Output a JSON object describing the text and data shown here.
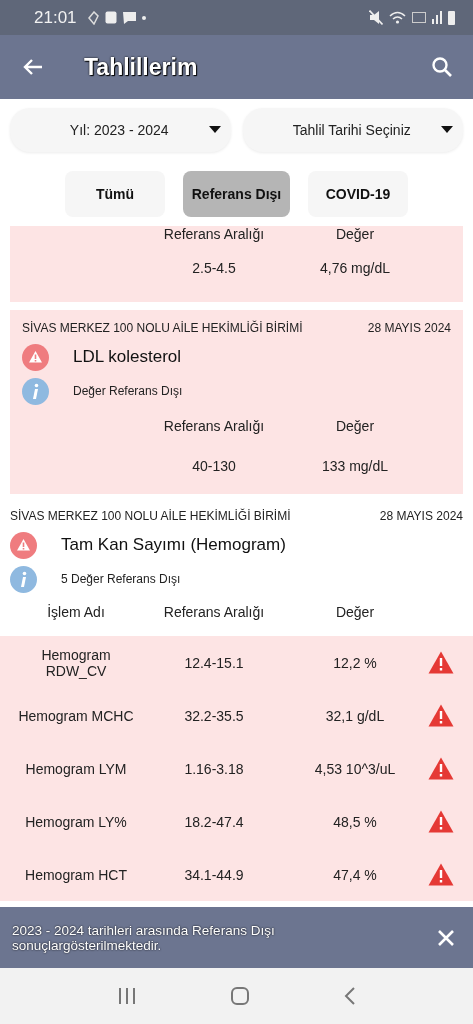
{
  "status_bar": {
    "time": "21:01"
  },
  "app_bar": {
    "title": "Tahlillerim"
  },
  "filters": [
    {
      "label": "Yıl: 2023 - 2024"
    },
    {
      "label": "Tahlil Tarihi Seçiniz"
    }
  ],
  "tabs": [
    {
      "label": "Tümü",
      "selected": false
    },
    {
      "label": "Referans Dışı",
      "selected": true
    },
    {
      "label": "COVID-19",
      "selected": false
    }
  ],
  "results": [
    {
      "kind": "partial",
      "flagged": true,
      "range_label": "Referans Aralığı",
      "value_label": "Değer",
      "range": "2.5-4.5",
      "value": "4,76 mg/dL"
    },
    {
      "kind": "single",
      "flagged": true,
      "clinic": "SİVAS MERKEZ 100 NOLU AİLE HEKİMLİĞİ BİRİMİ",
      "date": "28 MAYIS 2024",
      "test": "LDL kolesterol",
      "note": "Değer Referans Dışı",
      "range_label": "Referans Aralığı",
      "value_label": "Değer",
      "range": "40-130",
      "value": "133 mg/dL"
    },
    {
      "kind": "panel",
      "flagged": false,
      "clinic": "SİVAS MERKEZ 100 NOLU AİLE HEKİMLİĞİ BİRİMİ",
      "date": "28 MAYIS 2024",
      "test": "Tam Kan Sayımı (Hemogram)",
      "note": "5 Değer Referans Dışı",
      "columns": [
        "İşlem Adı",
        "Referans Aralığı",
        "Değer"
      ],
      "rows": [
        {
          "name": "Hemogram RDW_CV",
          "range": "12.4-15.1",
          "value": "12,2 %",
          "flagged": true
        },
        {
          "name": "Hemogram MCHC",
          "range": "32.2-35.5",
          "value": "32,1 g/dL",
          "flagged": true
        },
        {
          "name": "Hemogram LYM",
          "range": "1.16-3.18",
          "value": "4,53 10^3/uL",
          "flagged": true
        },
        {
          "name": "Hemogram LY%",
          "range": "18.2-47.4",
          "value": "48,5 %",
          "flagged": true
        },
        {
          "name": "Hemogram HCT",
          "range": "34.1-44.9",
          "value": "47,4 %",
          "flagged": true
        }
      ]
    }
  ],
  "snackbar": {
    "message": "2023 - 2024 tarihleri arasında Referans Dışı sonuçlargösterilmektedir."
  }
}
